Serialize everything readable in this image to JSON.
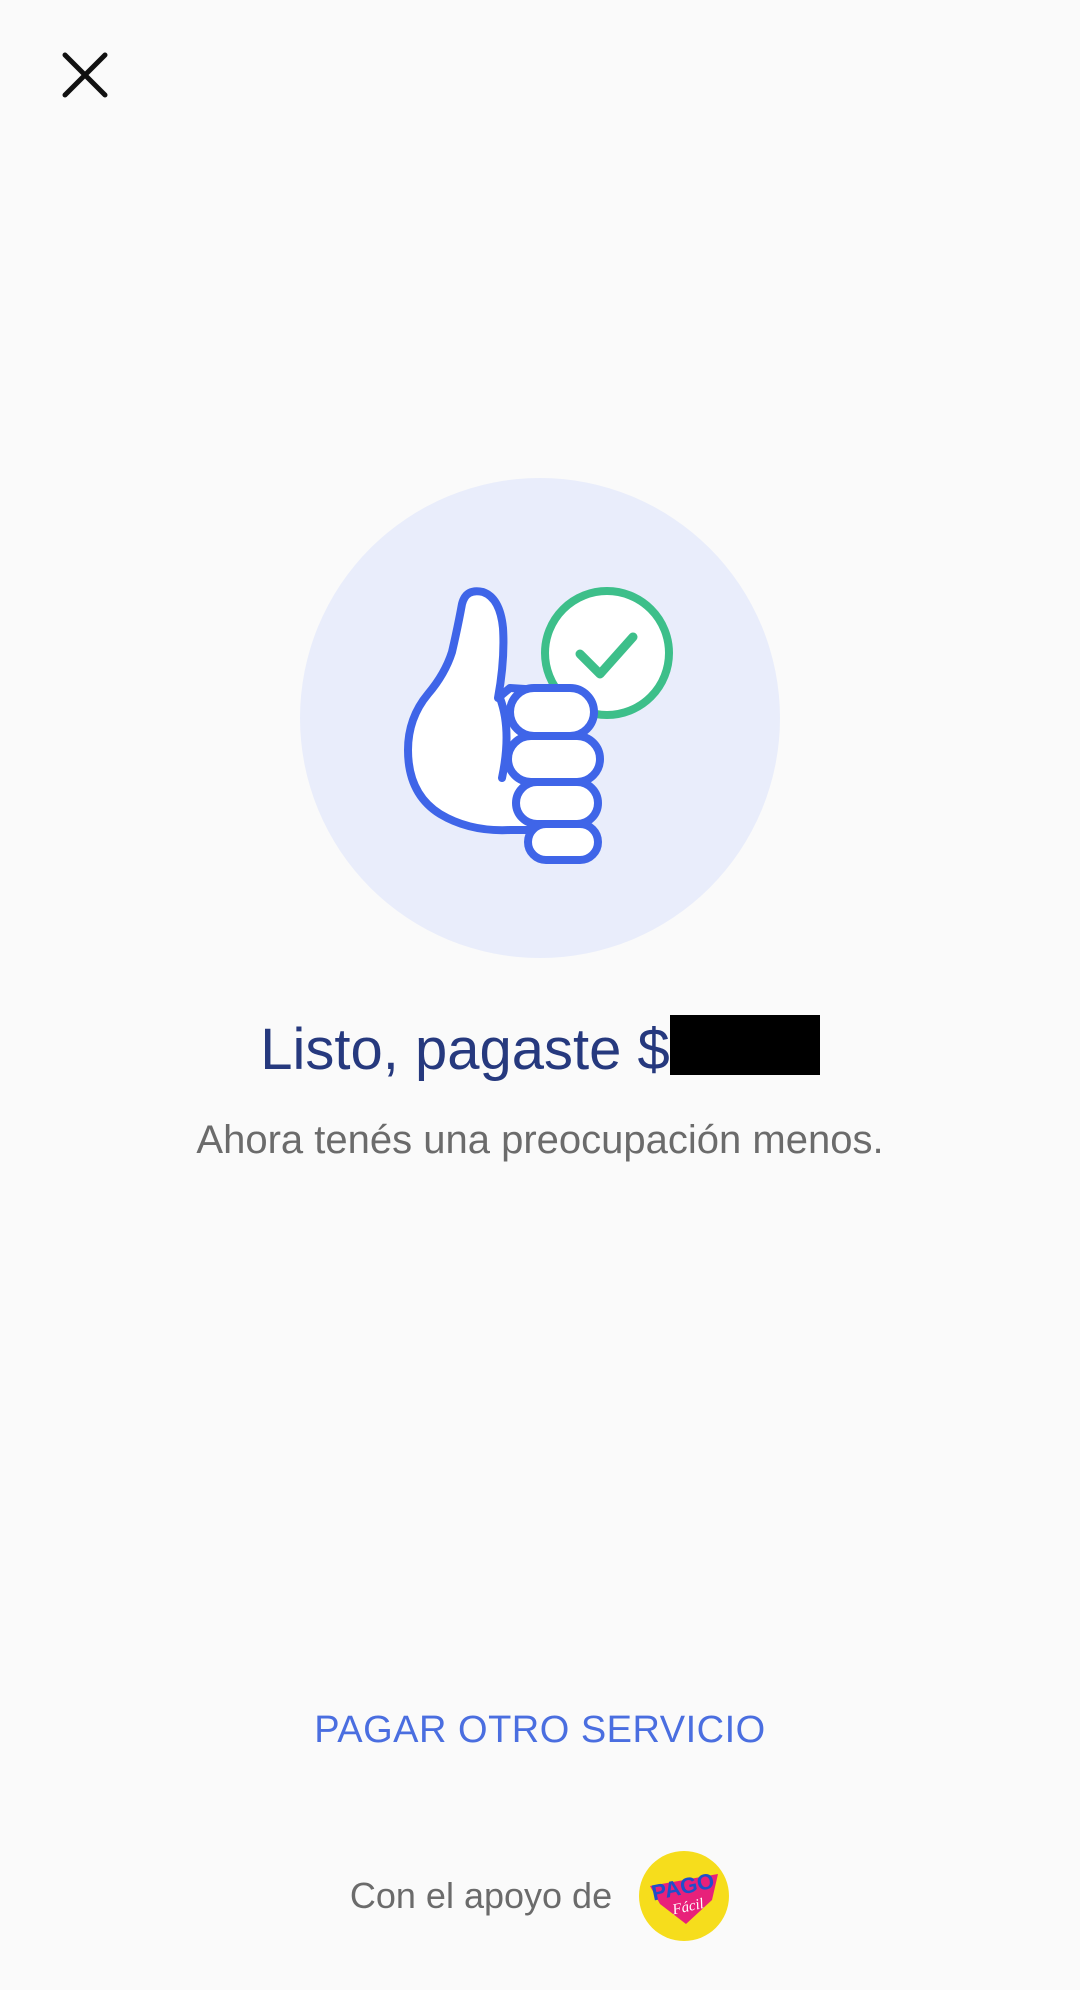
{
  "header": {
    "close_icon": "close-icon"
  },
  "hero": {
    "illustration_icon": "thumbs-up-check-icon"
  },
  "confirmation": {
    "title": "Listo, pagaste $",
    "subtitle": "Ahora tenés una preocupación menos."
  },
  "actions": {
    "pay_other_label": "PAGAR OTRO SERVICIO"
  },
  "footer": {
    "support_text": "Con el apoyo de",
    "logo_top": "PAGO",
    "logo_bottom": "Fácil"
  },
  "colors": {
    "background": "#fafafa",
    "title": "#26397e",
    "accent_blue": "#4a6ee0",
    "check_green": "#3dbf8a",
    "logo_yellow": "#f6dd1c",
    "logo_pink": "#e8217a"
  }
}
